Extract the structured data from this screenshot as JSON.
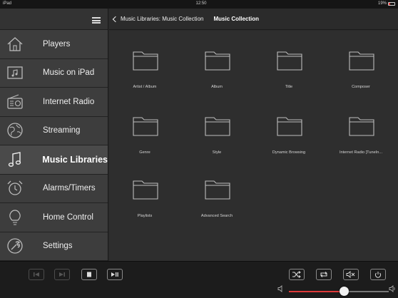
{
  "status": {
    "device": "iPad",
    "time": "12:50",
    "battery": "19%"
  },
  "sidebar": {
    "items": [
      {
        "label": "Players",
        "icon": "house-icon"
      },
      {
        "label": "Music on iPad",
        "icon": "music-file-icon"
      },
      {
        "label": "Internet Radio",
        "icon": "radio-icon"
      },
      {
        "label": "Streaming",
        "icon": "globe-icon"
      },
      {
        "label": "Music Libraries",
        "icon": "music-note-icon",
        "active": true
      },
      {
        "label": "Alarms/Timers",
        "icon": "alarm-clock-icon"
      },
      {
        "label": "Home Control",
        "icon": "lightbulb-icon"
      },
      {
        "label": "Settings",
        "icon": "wrench-icon"
      }
    ]
  },
  "topbar": {
    "back_label": "Music Libraries: Music Collection",
    "title": "Music Collection"
  },
  "folders": [
    "Artist / Album",
    "Album",
    "Title",
    "Composer",
    "Genre",
    "Style",
    "Dynamic Browsing",
    "Internet Radio [TuneIn...",
    "Playlists",
    "Advanced Search"
  ],
  "player": {
    "controls": [
      "previous-icon",
      "next-icon",
      "stop-icon",
      "play-pause-icon"
    ],
    "right_controls": [
      "shuffle-icon",
      "repeat-icon",
      "mute-icon",
      "power-icon"
    ],
    "volume": 0.55,
    "accent": "#e03a3a"
  }
}
